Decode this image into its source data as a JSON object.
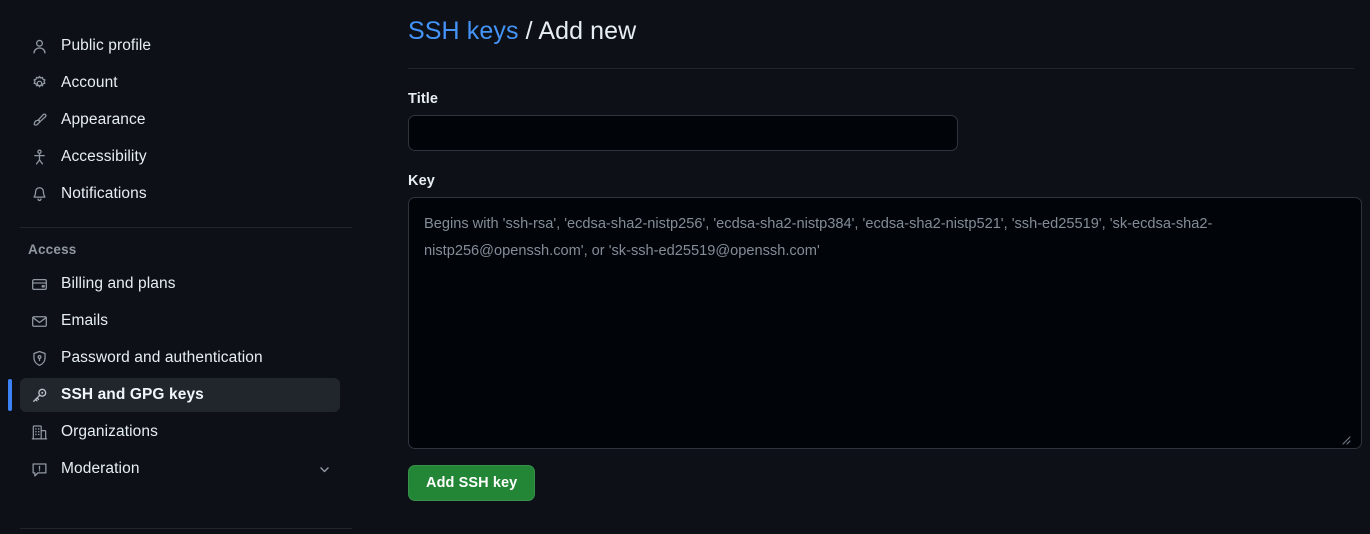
{
  "sidebar": {
    "primary_items": [
      {
        "label": "Public profile",
        "icon": "person-icon",
        "name": "sidebar-item-public-profile"
      },
      {
        "label": "Account",
        "icon": "gear-icon",
        "name": "sidebar-item-account"
      },
      {
        "label": "Appearance",
        "icon": "paintbrush-icon",
        "name": "sidebar-item-appearance"
      },
      {
        "label": "Accessibility",
        "icon": "accessibility-icon",
        "name": "sidebar-item-accessibility"
      },
      {
        "label": "Notifications",
        "icon": "bell-icon",
        "name": "sidebar-item-notifications"
      }
    ],
    "access_section": {
      "heading": "Access",
      "items": [
        {
          "label": "Billing and plans",
          "icon": "credit-card-icon",
          "name": "sidebar-item-billing-and-plans",
          "active": false,
          "chevron": false
        },
        {
          "label": "Emails",
          "icon": "mail-icon",
          "name": "sidebar-item-emails",
          "active": false,
          "chevron": false
        },
        {
          "label": "Password and authentication",
          "icon": "shield-lock-icon",
          "name": "sidebar-item-password-and-authentication",
          "active": false,
          "chevron": false
        },
        {
          "label": "SSH and GPG keys",
          "icon": "key-icon",
          "name": "sidebar-item-ssh-and-gpg-keys",
          "active": true,
          "chevron": false
        },
        {
          "label": "Organizations",
          "icon": "organization-icon",
          "name": "sidebar-item-organizations",
          "active": false,
          "chevron": false
        },
        {
          "label": "Moderation",
          "icon": "report-icon",
          "name": "sidebar-item-moderation",
          "active": false,
          "chevron": true
        }
      ]
    }
  },
  "main": {
    "breadcrumb": {
      "link_text": "SSH keys",
      "separator": "/",
      "current": "Add new"
    },
    "title_field": {
      "label": "Title",
      "value": "",
      "placeholder": ""
    },
    "key_field": {
      "label": "Key",
      "value": "",
      "placeholder": "Begins with 'ssh-rsa', 'ecdsa-sha2-nistp256', 'ecdsa-sha2-nistp384', 'ecdsa-sha2-nistp521', 'ssh-ed25519', 'sk-ecdsa-sha2-nistp256@openssh.com', or 'sk-ssh-ed25519@openssh.com'"
    },
    "submit_button": "Add SSH key"
  },
  "colors": {
    "background": "#0d1117",
    "accent_link": "#4493f8",
    "active_indicator": "#3b82f6",
    "active_row_bg": "#21262d",
    "button_green": "#238636",
    "input_bg": "#010409",
    "border": "#2f353d",
    "muted_text": "#9198a1",
    "placeholder_text": "#848d97"
  }
}
